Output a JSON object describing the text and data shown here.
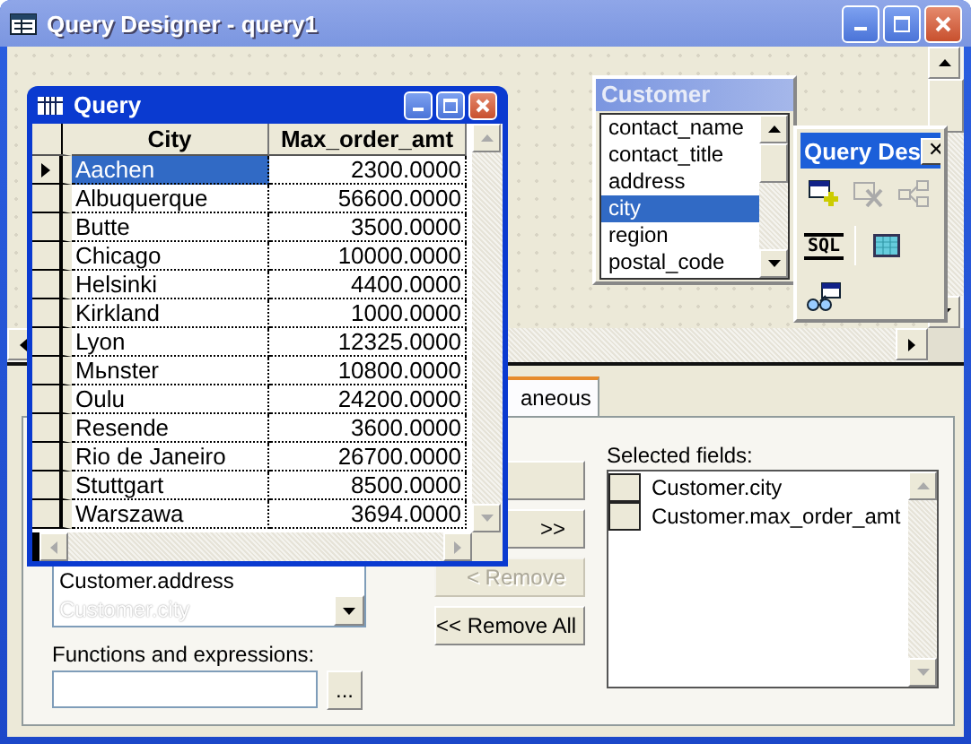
{
  "window": {
    "title": "Query Designer - query1"
  },
  "query_window": {
    "title": "Query",
    "columns": [
      "City",
      "Max_order_amt"
    ],
    "rows": [
      {
        "city": "Aachen",
        "amount": "2300.0000",
        "selected": true
      },
      {
        "city": "Albuquerque",
        "amount": "56600.0000",
        "selected": false
      },
      {
        "city": "Butte",
        "amount": "3500.0000",
        "selected": false
      },
      {
        "city": "Chicago",
        "amount": "10000.0000",
        "selected": false
      },
      {
        "city": "Helsinki",
        "amount": "4400.0000",
        "selected": false
      },
      {
        "city": "Kirkland",
        "amount": "1000.0000",
        "selected": false
      },
      {
        "city": "Lyon",
        "amount": "12325.0000",
        "selected": false
      },
      {
        "city": "Mьnster",
        "amount": "10800.0000",
        "selected": false
      },
      {
        "city": "Oulu",
        "amount": "24200.0000",
        "selected": false
      },
      {
        "city": "Resende",
        "amount": "3600.0000",
        "selected": false
      },
      {
        "city": "Rio de Janeiro",
        "amount": "26700.0000",
        "selected": false
      },
      {
        "city": "Stuttgart",
        "amount": "8500.0000",
        "selected": false
      },
      {
        "city": "Warszawa",
        "amount": "3694.0000",
        "selected": false
      }
    ]
  },
  "table_window": {
    "title": "Customer",
    "fields": [
      {
        "name": "contact_name",
        "selected": false
      },
      {
        "name": "contact_title",
        "selected": false
      },
      {
        "name": "address",
        "selected": false
      },
      {
        "name": "city",
        "selected": true
      },
      {
        "name": "region",
        "selected": false
      },
      {
        "name": "postal_code",
        "selected": false
      }
    ]
  },
  "toolbar": {
    "title": "Query Des",
    "close": "✕",
    "tools": [
      {
        "kind": "add-table",
        "disabled": false
      },
      {
        "kind": "remove-table",
        "disabled": true
      },
      {
        "kind": "join",
        "disabled": true
      },
      {
        "kind": "sql",
        "label": "SQL",
        "disabled": false
      },
      {
        "kind": "grid",
        "disabled": false
      },
      {
        "kind": "view",
        "disabled": false
      }
    ]
  },
  "tabs": [
    {
      "label": "aneous",
      "selected": true
    }
  ],
  "field_list": {
    "items": [
      {
        "text": "Customer.address",
        "faded": false
      },
      {
        "text": "Customer.city",
        "faded": true
      }
    ]
  },
  "functions": {
    "label": "Functions and expressions:",
    "button": "..."
  },
  "buttons": [
    {
      "disabled": false
    },
    {
      "label": ">>",
      "disabled": false
    },
    {
      "label": "< Remove",
      "disabled": true
    },
    {
      "label": "<< Remove All",
      "disabled": false
    }
  ],
  "selected_fields": {
    "label": "Selected fields:",
    "items": [
      "Customer.city",
      "Customer.max_order_amt"
    ]
  }
}
